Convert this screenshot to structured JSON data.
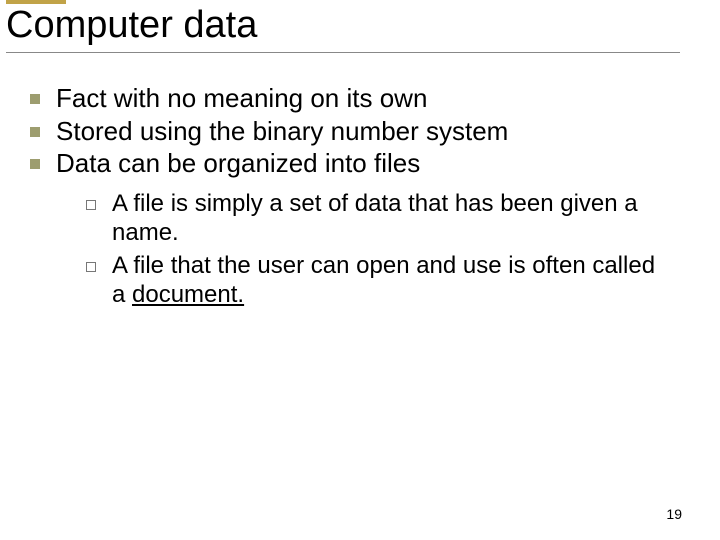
{
  "slide": {
    "title": "Computer data",
    "bullets": {
      "b1": "Fact with no meaning on its own",
      "b2": "Stored using the binary number system",
      "b3": "Data can be organized into files"
    },
    "sub": {
      "s1": "A file is simply a set of data that has been given a name.",
      "s2_prefix": " A file that the user can open and use is often called a ",
      "s2_underlined": "document."
    },
    "page_number": "19"
  }
}
